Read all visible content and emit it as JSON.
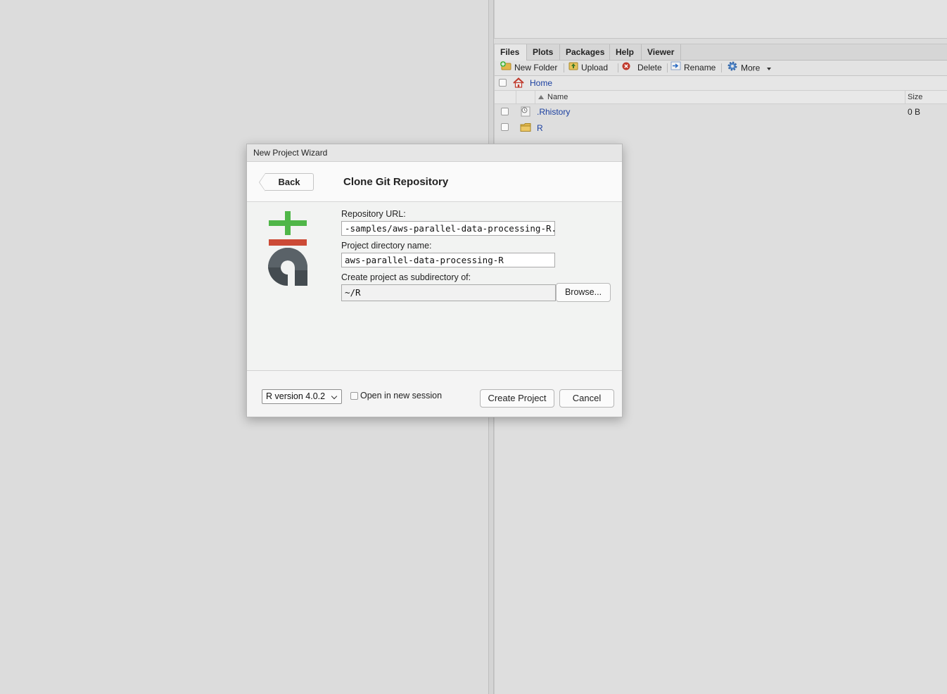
{
  "files_pane": {
    "tabs": [
      {
        "label": "Files"
      },
      {
        "label": "Plots"
      },
      {
        "label": "Packages"
      },
      {
        "label": "Help"
      },
      {
        "label": "Viewer"
      }
    ],
    "toolbar": {
      "new_folder": "New Folder",
      "upload": "Upload",
      "delete": "Delete",
      "rename": "Rename",
      "more": "More"
    },
    "breadcrumb": "Home",
    "columns": {
      "name": "Name",
      "size": "Size"
    },
    "files": [
      {
        "name": ".Rhistory",
        "size": "0 B",
        "type": "history-file-icon"
      },
      {
        "name": "R",
        "size": "",
        "type": "folder-icon"
      }
    ]
  },
  "dialog": {
    "title": "New Project Wizard",
    "back_label": "Back",
    "heading": "Clone Git Repository",
    "logo_icon": "git-logo-icon",
    "repo_url_label": "Repository URL:",
    "repo_url_value": "-samples/aws-parallel-data-processing-R.git",
    "dir_name_label": "Project directory name:",
    "dir_name_value": "aws-parallel-data-processing-R",
    "subdir_label": "Create project as subdirectory of:",
    "subdir_value": "~/R",
    "browse_label": "Browse...",
    "r_version": "R version 4.0.2",
    "open_new_session": "Open in new session",
    "open_new_session_checked": false,
    "create_label": "Create Project",
    "cancel_label": "Cancel"
  },
  "colors": {
    "git_green": "#4fb648",
    "git_red": "#cc4a36",
    "git_dark": "#444b50",
    "link": "#1a3fa0"
  }
}
